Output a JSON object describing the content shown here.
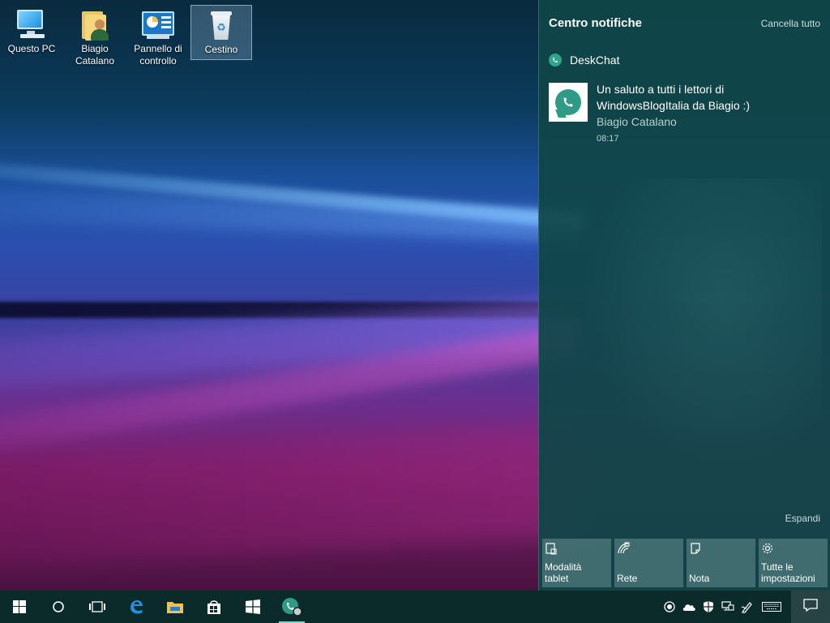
{
  "desktop": {
    "icons": [
      {
        "label_line1": "Questo PC",
        "label_line2": ""
      },
      {
        "label_line1": "Biagio",
        "label_line2": "Catalano"
      },
      {
        "label_line1": "Pannello di",
        "label_line2": "controllo"
      },
      {
        "label_line1": "Cestino",
        "label_line2": ""
      }
    ]
  },
  "action_center": {
    "title": "Centro notifiche",
    "clear_all": "Cancella tutto",
    "app_group": {
      "name": "DeskChat",
      "notification": {
        "line1": "Un saluto a tutti i lettori di",
        "line2": "WindowsBlogItalia da Biagio :)",
        "sender": "Biagio Catalano",
        "time": "08:17"
      }
    },
    "expand": "Espandi",
    "quick_actions": [
      {
        "icon": "tablet-mode-icon",
        "label_line1": "Modalità",
        "label_line2": "tablet"
      },
      {
        "icon": "network-icon",
        "label_line1": "",
        "label_line2": "Rete"
      },
      {
        "icon": "note-icon",
        "label_line1": "",
        "label_line2": "Nota"
      },
      {
        "icon": "settings-gear-icon",
        "label_line1": "Tutte le",
        "label_line2": "impostazioni"
      }
    ]
  },
  "taskbar": {
    "pinned": [
      "start-icon",
      "cortana-search-icon",
      "task-view-icon",
      "edge-icon",
      "file-explorer-icon",
      "store-icon",
      "mail-tile-icon",
      "deskchat-icon"
    ],
    "tray": [
      "record-icon",
      "onedrive-icon",
      "defender-icon",
      "network-wired-icon",
      "pen-ink-icon",
      "touch-keyboard-icon",
      "action-center-icon"
    ]
  },
  "colors": {
    "action_center_bg": "#104648",
    "taskbar_bg": "#0b2a2a",
    "accent": "#2f9a86"
  }
}
